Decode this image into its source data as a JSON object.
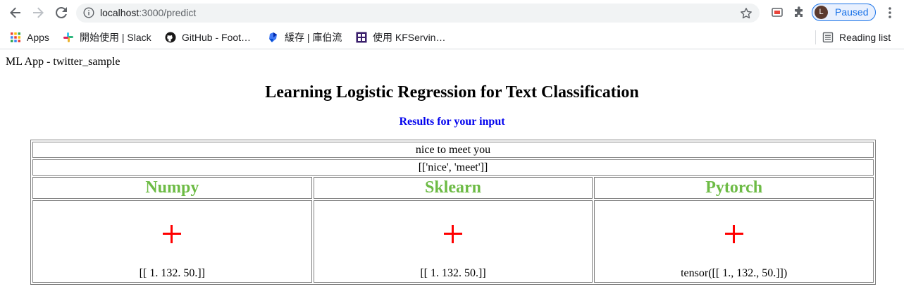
{
  "browser": {
    "url_host": "localhost",
    "url_rest": ":3000/predict",
    "profile_initial": "L",
    "profile_label": "Paused",
    "bookmarks": [
      {
        "label": "Apps",
        "icon": "apps-grid-icon"
      },
      {
        "label": "開始使用 | Slack",
        "icon": "slack-icon"
      },
      {
        "label": "GitHub - Foot…",
        "icon": "github-icon"
      },
      {
        "label": "緩存 | 庫伯流",
        "icon": "kubeflow-icon"
      },
      {
        "label": "使用 KFServin…",
        "icon": "kfserving-icon"
      }
    ],
    "reading_list": "Reading list"
  },
  "page": {
    "app_label": "ML App - twitter_sample",
    "title": "Learning Logistic Regression for Text Classification",
    "results_heading": "Results for your input"
  },
  "results": {
    "input_text": "nice to meet you",
    "tokens": "[['nice', 'meet']]",
    "models": [
      {
        "name": "Numpy",
        "prediction_icon": "plus-icon",
        "features": "[[ 1. 132. 50.]]"
      },
      {
        "name": "Sklearn",
        "prediction_icon": "plus-icon",
        "features": "[[ 1. 132. 50.]]"
      },
      {
        "name": "Pytorch",
        "prediction_icon": "plus-icon",
        "features": "tensor([[ 1., 132., 50.]])"
      }
    ]
  },
  "colors": {
    "model_heading": "#6dbb45",
    "prediction_positive": "#ff0000",
    "link_heading": "#0000ee"
  }
}
